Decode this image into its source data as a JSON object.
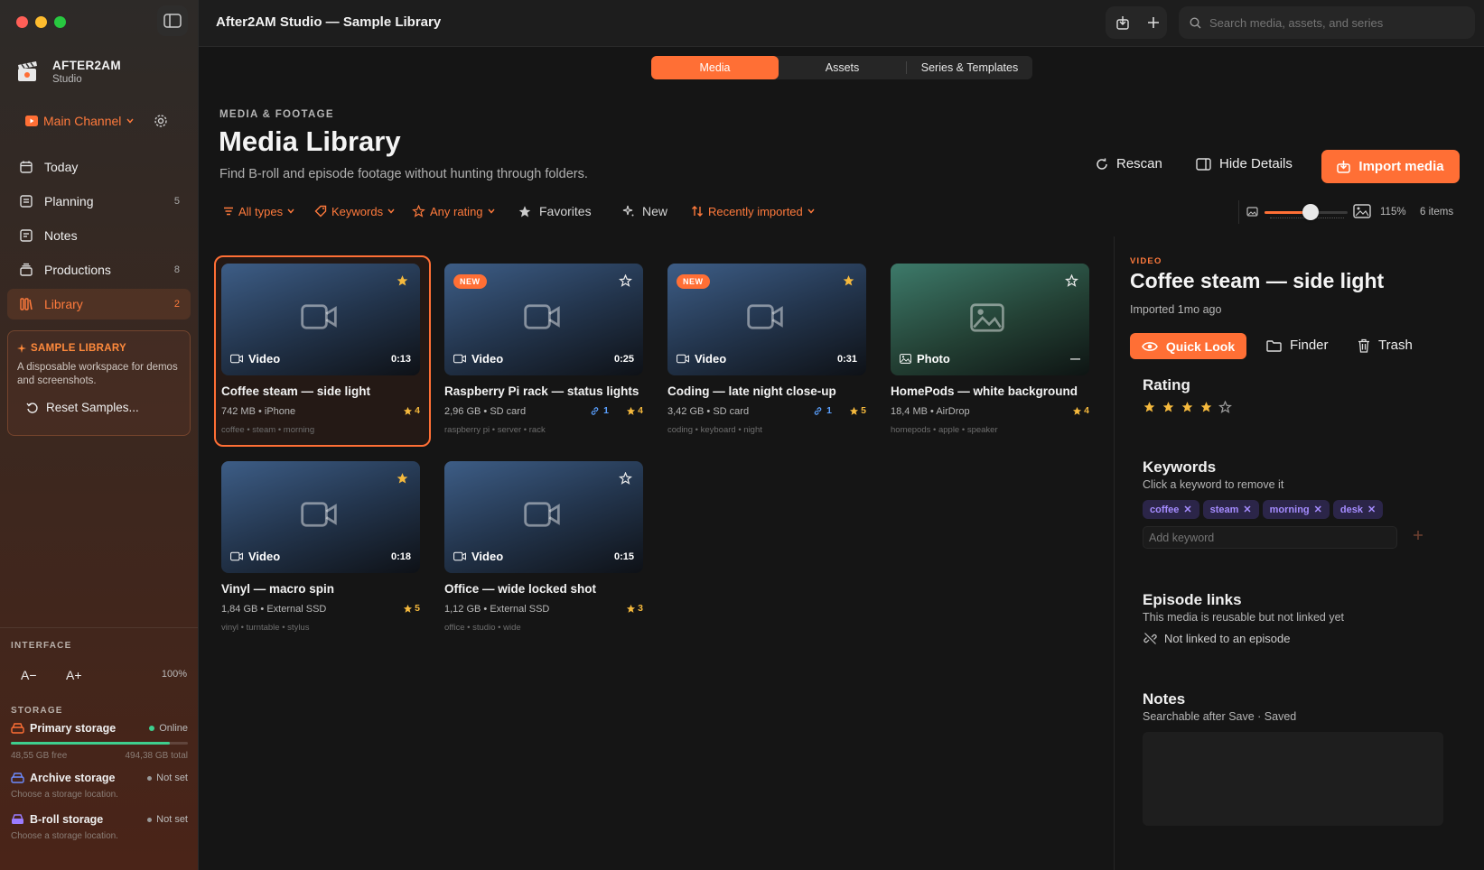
{
  "window": {
    "title": "After2AM Studio — Sample Library"
  },
  "search": {
    "placeholder": "Search media, assets, and series"
  },
  "brand": {
    "name": "AFTER2AM",
    "sub": "Studio"
  },
  "channel": {
    "label": "Main Channel"
  },
  "nav": [
    {
      "label": "Today",
      "count": ""
    },
    {
      "label": "Planning",
      "count": "5"
    },
    {
      "label": "Notes",
      "count": ""
    },
    {
      "label": "Productions",
      "count": "8"
    },
    {
      "label": "Library",
      "count": "2"
    }
  ],
  "sample": {
    "title": "SAMPLE LIBRARY",
    "desc": "A disposable workspace for demos and screenshots.",
    "reset": "Reset Samples..."
  },
  "interface": {
    "label": "INTERFACE",
    "dec": "A−",
    "inc": "A+",
    "zoom": "100%"
  },
  "storage": {
    "label": "STORAGE",
    "primary": {
      "name": "Primary storage",
      "status": "Online",
      "free": "48,55 GB free",
      "total": "494,38 GB total",
      "used_fraction": 0.9
    },
    "archive": {
      "name": "Archive storage",
      "status": "Not set",
      "sub": "Choose a storage location."
    },
    "broll": {
      "name": "B-roll storage",
      "status": "Not set",
      "sub": "Choose a storage location."
    }
  },
  "tabs": [
    "Media",
    "Assets",
    "Series & Templates"
  ],
  "header": {
    "eyebrow": "MEDIA & FOOTAGE",
    "title": "Media Library",
    "subtitle": "Find B-roll and episode footage without hunting through folders."
  },
  "actions": {
    "rescan": "Rescan",
    "hide": "Hide Details",
    "import": "Import media"
  },
  "filters": {
    "types": "All types",
    "keywords": "Keywords",
    "rating": "Any rating",
    "favorites": "Favorites",
    "new": "New",
    "sort": "Recently imported"
  },
  "view": {
    "zoom": "115%",
    "count": "6 items",
    "slider_fraction": 0.55
  },
  "cards": [
    {
      "kind": "Video",
      "dur": "0:13",
      "title": "Coffee steam — side light",
      "meta": "742 MB • iPhone",
      "tags": "coffee • steam • morning",
      "rating": "4",
      "links": "",
      "isNew": false,
      "fav": true
    },
    {
      "kind": "Video",
      "dur": "0:25",
      "title": "Raspberry Pi rack — status lights",
      "meta": "2,96 GB • SD card",
      "tags": "raspberry pi • server • rack",
      "rating": "4",
      "links": "1",
      "isNew": true,
      "fav": false
    },
    {
      "kind": "Video",
      "dur": "0:31",
      "title": "Coding — late night close-up",
      "meta": "3,42 GB • SD card",
      "tags": "coding • keyboard • night",
      "rating": "5",
      "links": "1",
      "isNew": true,
      "fav": true
    },
    {
      "kind": "Photo",
      "dur": "—",
      "title": "HomePods — white background",
      "meta": "18,4 MB • AirDrop",
      "tags": "homepods • apple • speaker",
      "rating": "4",
      "links": "",
      "isNew": false,
      "fav": false
    },
    {
      "kind": "Video",
      "dur": "0:18",
      "title": "Vinyl — macro spin",
      "meta": "1,84 GB • External SSD",
      "tags": "vinyl • turntable • stylus",
      "rating": "5",
      "links": "",
      "isNew": false,
      "fav": true
    },
    {
      "kind": "Video",
      "dur": "0:15",
      "title": "Office — wide locked shot",
      "meta": "1,12 GB • External SSD",
      "tags": "office • studio • wide",
      "rating": "3",
      "links": "",
      "isNew": false,
      "fav": false
    }
  ],
  "new_badge": "NEW",
  "detail": {
    "eyebrow": "VIDEO",
    "title": "Coffee steam — side light",
    "imported": "Imported 1mo ago",
    "quicklook": "Quick Look",
    "finder": "Finder",
    "trash": "Trash",
    "rating_label": "Rating",
    "rating_value": 4,
    "keywords_label": "Keywords",
    "keywords_hint": "Click a keyword to remove it",
    "keywords": [
      "coffee",
      "steam",
      "morning",
      "desk"
    ],
    "add_placeholder": "Add keyword",
    "episodes_label": "Episode links",
    "episodes_hint": "This media is reusable but not linked yet",
    "episodes_status": "Not linked to an episode",
    "notes_label": "Notes",
    "notes_hint": "Searchable after Save · Saved"
  },
  "colors": {
    "accent": "#ff6f35",
    "star": "#f5b93d",
    "online": "#3ecf8e",
    "keyword": "#a58cff"
  }
}
